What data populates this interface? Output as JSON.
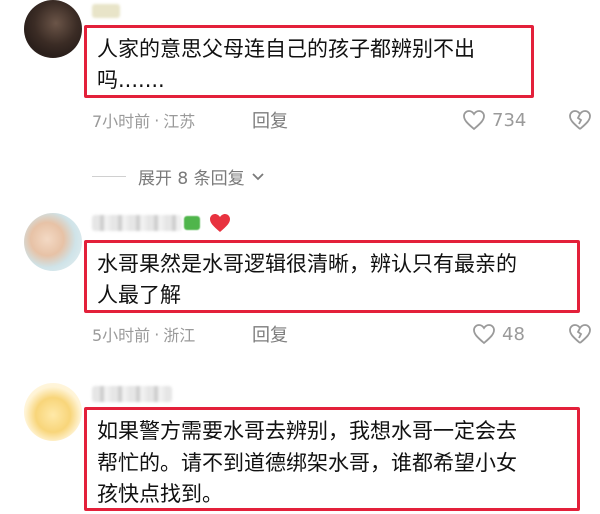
{
  "comments": [
    {
      "text_line1": "人家的意思父母连自己的孩子都辨别不出",
      "text_line2": "吗.......",
      "time": "7小时前",
      "sep": "·",
      "location": "江苏",
      "reply_label": "回复",
      "likes": "734"
    },
    {
      "text_line1": "水哥果然是水哥逻辑很清晰，辨认只有最亲的",
      "text_line2": "人最了解",
      "time": "5小时前",
      "sep": "·",
      "location": "浙江",
      "reply_label": "回复",
      "likes": "48"
    },
    {
      "text_line1": "如果警方需要水哥去辨别，我想水哥一定会去",
      "text_line2": "帮忙的。请不到道德绑架水哥，谁都希望小女",
      "text_line3": "孩快点找到。"
    }
  ],
  "expand_label": "展开 8 条回复",
  "colors": {
    "highlight_border": "#e3203a",
    "meta_gray": "#9a9a9a"
  },
  "icons": [
    "heart-outline-icon",
    "broken-heart-icon",
    "chevron-down-icon",
    "heart-emoji-icon"
  ]
}
